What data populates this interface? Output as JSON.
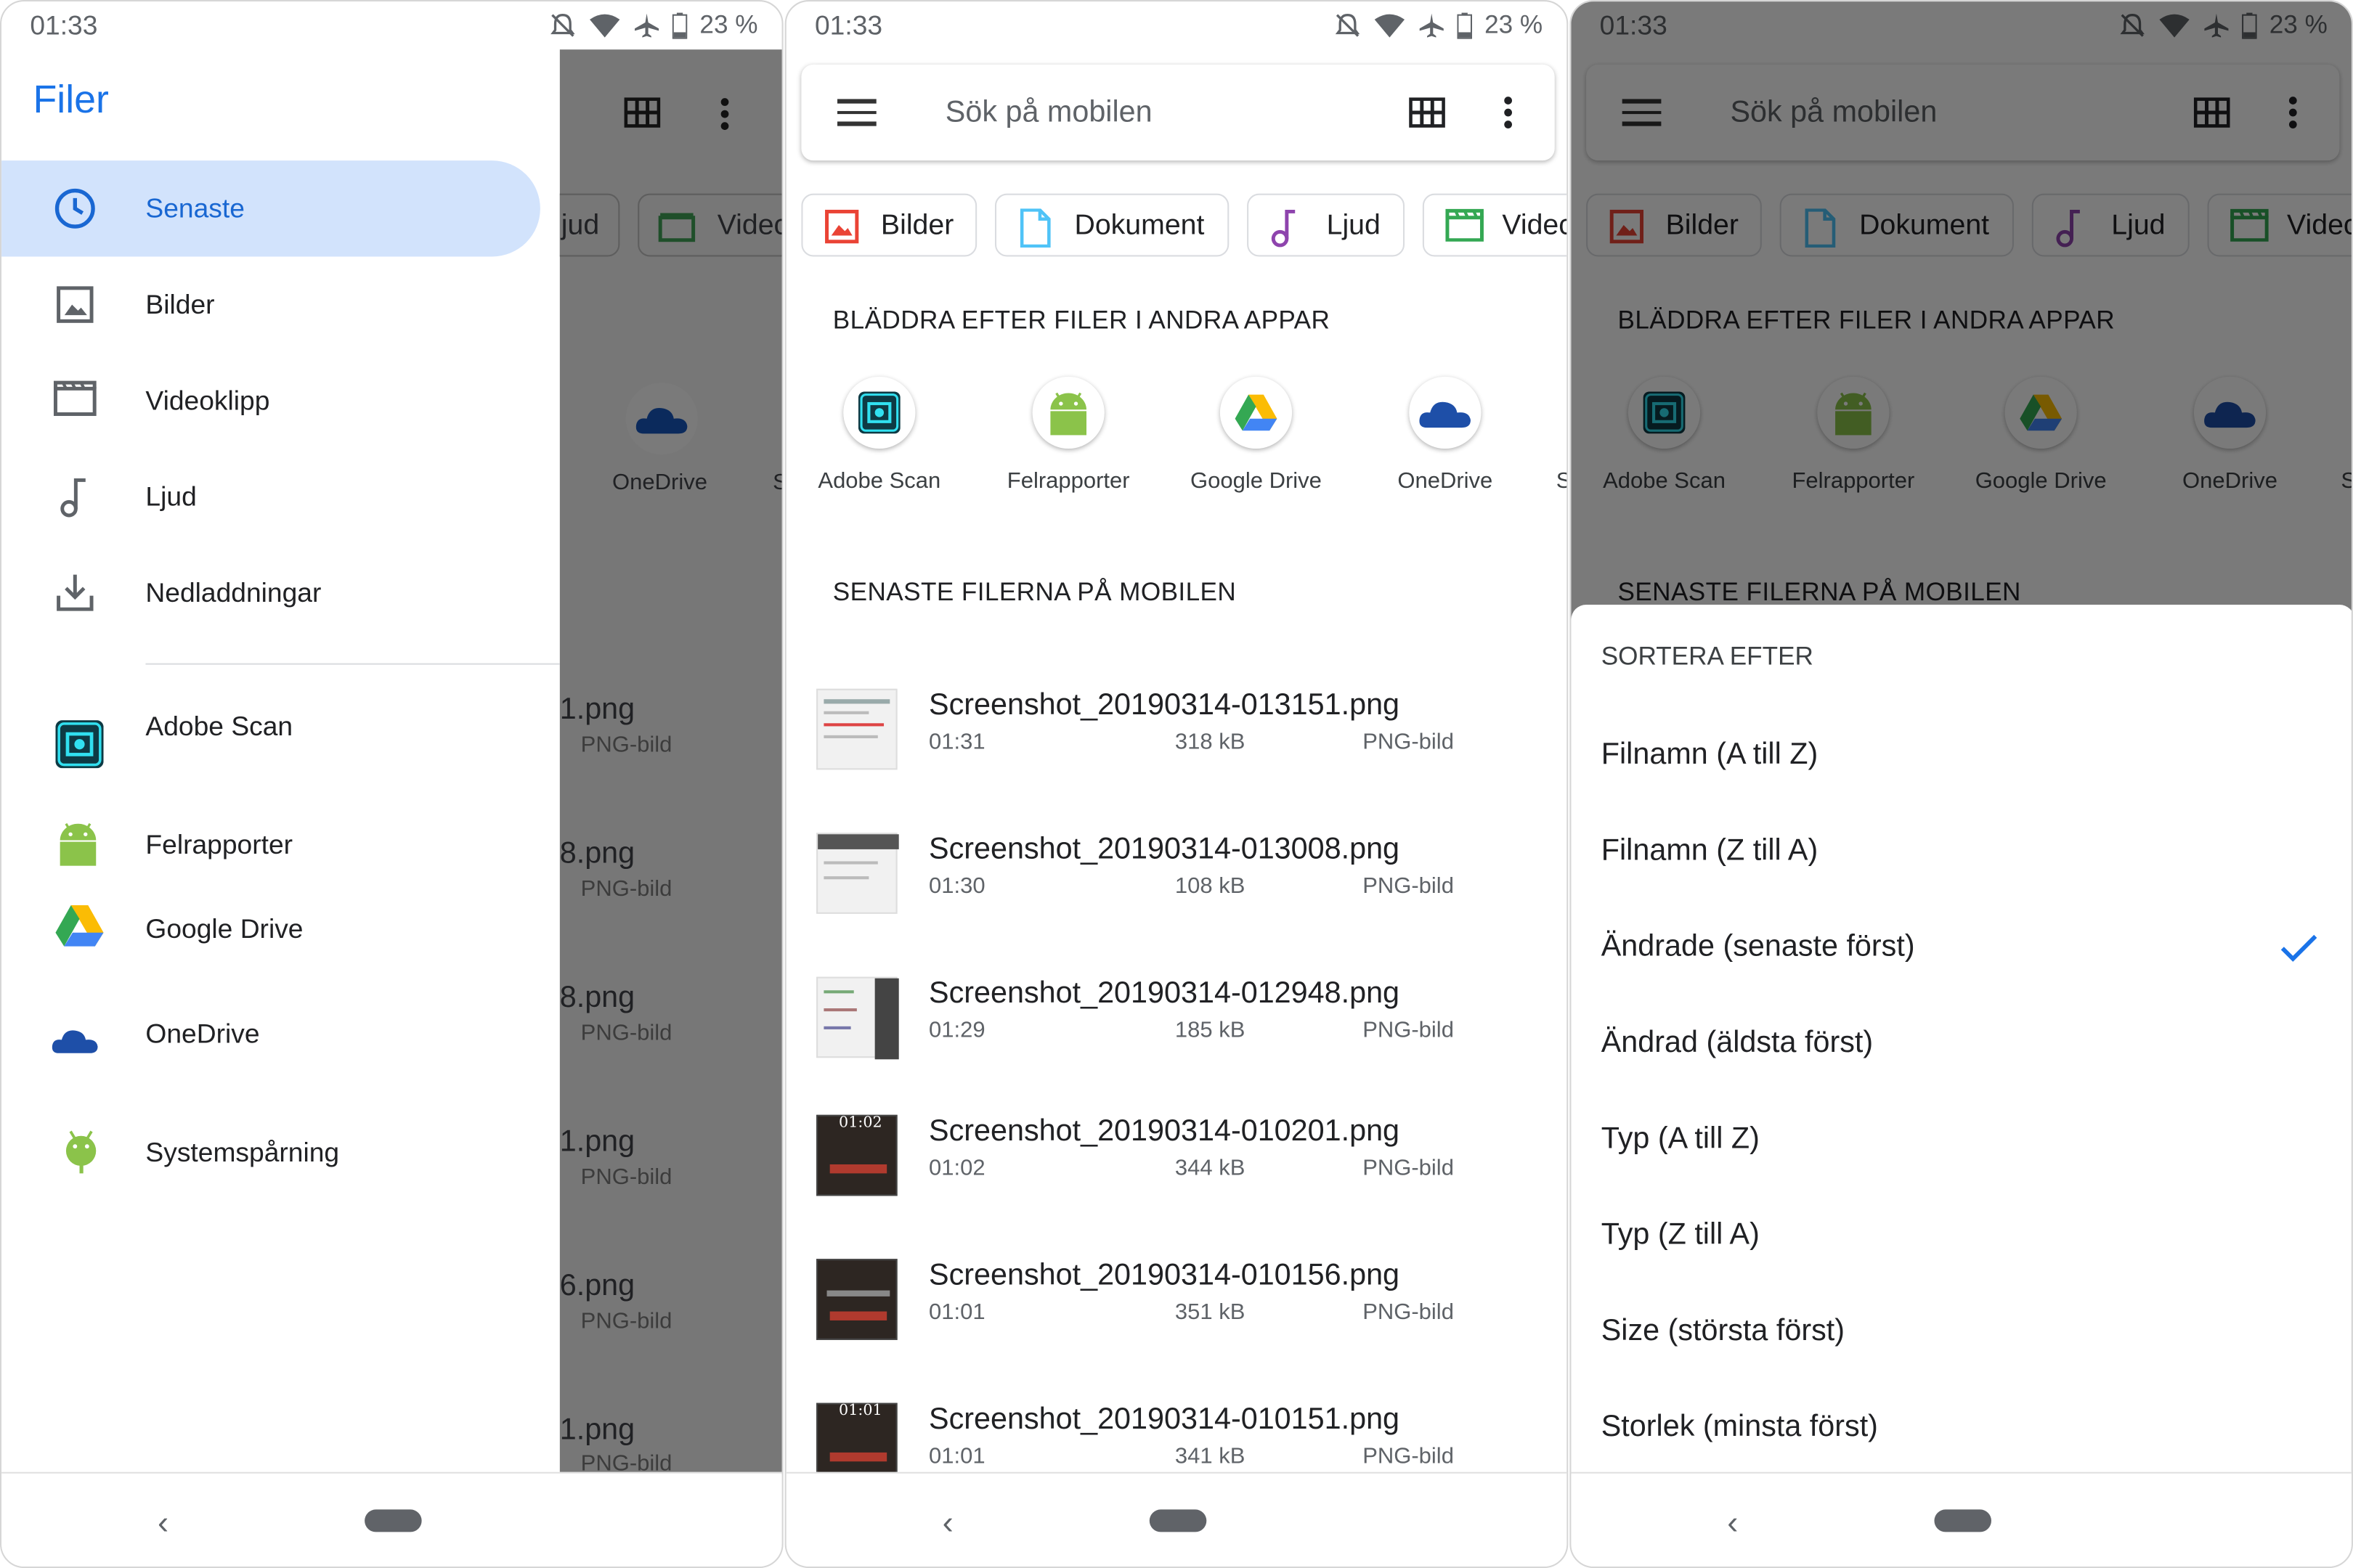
{
  "status": {
    "time": "01:33",
    "battery": "23 %"
  },
  "drawer": {
    "title": "Filer",
    "items": [
      {
        "label": "Senaste",
        "icon": "clock-icon",
        "active": true
      },
      {
        "label": "Bilder",
        "icon": "image-icon"
      },
      {
        "label": "Videoklipp",
        "icon": "video-icon"
      },
      {
        "label": "Ljud",
        "icon": "music-note-icon"
      },
      {
        "label": "Nedladdningar",
        "icon": "download-icon"
      }
    ],
    "apps": [
      {
        "label": "Adobe Scan",
        "icon": "adobe-scan-icon"
      },
      {
        "label": "Felrapporter",
        "icon": "android-icon"
      },
      {
        "label": "Google Drive",
        "icon": "google-drive-icon"
      },
      {
        "label": "OneDrive",
        "icon": "onedrive-icon"
      },
      {
        "label": "Systemspårning",
        "icon": "android-bug-icon"
      }
    ]
  },
  "behind": {
    "chips": [
      "jud",
      "Videc"
    ],
    "app_labels": [
      "OneDrive",
      "S"
    ],
    "files": [
      {
        "name": "1.png",
        "type": "PNG-bild"
      },
      {
        "name": "8.png",
        "type": "PNG-bild"
      },
      {
        "name": "8.png",
        "type": "PNG-bild"
      },
      {
        "name": "1.png",
        "type": "PNG-bild"
      },
      {
        "name": "6.png",
        "type": "PNG-bild"
      },
      {
        "name": "1.png",
        "type": "PNG-bild"
      }
    ]
  },
  "main": {
    "search_placeholder": "Sök på mobilen",
    "chips": [
      {
        "label": "Bilder",
        "icon": "image-icon"
      },
      {
        "label": "Dokument",
        "icon": "document-icon"
      },
      {
        "label": "Ljud",
        "icon": "music-note-icon"
      },
      {
        "label": "Videc",
        "icon": "video-icon"
      }
    ],
    "browse_title": "BLÄDDRA EFTER FILER I ANDRA APPAR",
    "apps": [
      {
        "label": "Adobe Scan",
        "icon": "adobe-scan-icon"
      },
      {
        "label": "Felrapporter",
        "icon": "android-icon"
      },
      {
        "label": "Google Drive",
        "icon": "google-drive-icon"
      },
      {
        "label": "OneDrive",
        "icon": "onedrive-icon"
      },
      {
        "label": "S",
        "icon": ""
      }
    ],
    "recent_title": "SENASTE FILERNA PÅ MOBILEN",
    "files": [
      {
        "name": "Screenshot_20190314-013151.png",
        "time": "01:31",
        "size": "318 kB",
        "type": "PNG-bild"
      },
      {
        "name": "Screenshot_20190314-013008.png",
        "time": "01:30",
        "size": "108 kB",
        "type": "PNG-bild"
      },
      {
        "name": "Screenshot_20190314-012948.png",
        "time": "01:29",
        "size": "185 kB",
        "type": "PNG-bild"
      },
      {
        "name": "Screenshot_20190314-010201.png",
        "time": "01:02",
        "size": "344 kB",
        "type": "PNG-bild"
      },
      {
        "name": "Screenshot_20190314-010156.png",
        "time": "01:01",
        "size": "351 kB",
        "type": "PNG-bild"
      },
      {
        "name": "Screenshot_20190314-010151.png",
        "time": "01:01",
        "size": "341 kB",
        "type": "PNG-bild"
      }
    ],
    "thumb_labels": [
      "01:02",
      "01:01"
    ]
  },
  "sort": {
    "title": "SORTERA EFTER",
    "options": [
      {
        "label": "Filnamn (A till Z)"
      },
      {
        "label": "Filnamn (Z till A)"
      },
      {
        "label": "Ändrade (senaste först)",
        "selected": true
      },
      {
        "label": "Ändrad (äldsta först)"
      },
      {
        "label": "Typ (A till Z)"
      },
      {
        "label": "Typ (Z till A)"
      },
      {
        "label": "Size (största först)"
      },
      {
        "label": "Storlek (minsta först)"
      }
    ]
  },
  "colors": {
    "accent": "#1a73e8",
    "drawer_highlight": "#d2e3fc"
  }
}
